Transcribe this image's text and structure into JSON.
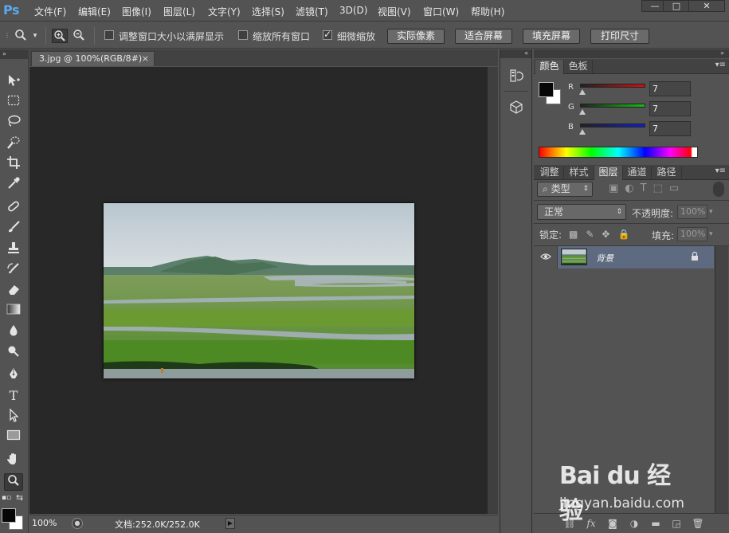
{
  "app": {
    "logo": "Ps"
  },
  "menu": [
    "文件(F)",
    "编辑(E)",
    "图像(I)",
    "图层(L)",
    "文字(Y)",
    "选择(S)",
    "滤镜(T)",
    "3D(D)",
    "视图(V)",
    "窗口(W)",
    "帮助(H)"
  ],
  "window_controls": {
    "minimize": "—",
    "maximize": "□",
    "close": "✕"
  },
  "options_bar": {
    "resize_windows_label": "调整窗口大小以满屏显示",
    "resize_windows_checked": false,
    "zoom_all_label": "缩放所有窗口",
    "zoom_all_checked": false,
    "scrubby_zoom_label": "细微缩放",
    "scrubby_zoom_checked": true,
    "actual_pixels": "实际像素",
    "fit_screen": "适合屏幕",
    "fill_screen": "填充屏幕",
    "print_size": "打印尺寸"
  },
  "document": {
    "tab_title": "3.jpg @ 100%(RGB/8#)",
    "tab_close": "×"
  },
  "status": {
    "zoom": "100%",
    "doc_info": "文档:252.0K/252.0K"
  },
  "color_panel": {
    "tabs": [
      "颜色",
      "色板"
    ],
    "active_tab": 0,
    "channels": [
      {
        "label": "R",
        "value": "7",
        "color": "#d01010"
      },
      {
        "label": "G",
        "value": "7",
        "color": "#10c010"
      },
      {
        "label": "B",
        "value": "7",
        "color": "#1020d0"
      }
    ],
    "foreground": "#070707",
    "background": "#ffffff"
  },
  "layers_panel": {
    "tabs": [
      "调整",
      "样式",
      "图层",
      "通道",
      "路径"
    ],
    "active_tab": 2,
    "filter_kind": "类型",
    "blend_mode": "正常",
    "opacity_label": "不透明度:",
    "opacity_value": "100%",
    "lock_label": "锁定:",
    "fill_label": "填充:",
    "fill_value": "100%",
    "layers": [
      {
        "name": "背景",
        "visible": true,
        "locked": true
      }
    ]
  },
  "watermark": {
    "brand": "Bai du 经验",
    "url": "jingyan.baidu.com"
  }
}
